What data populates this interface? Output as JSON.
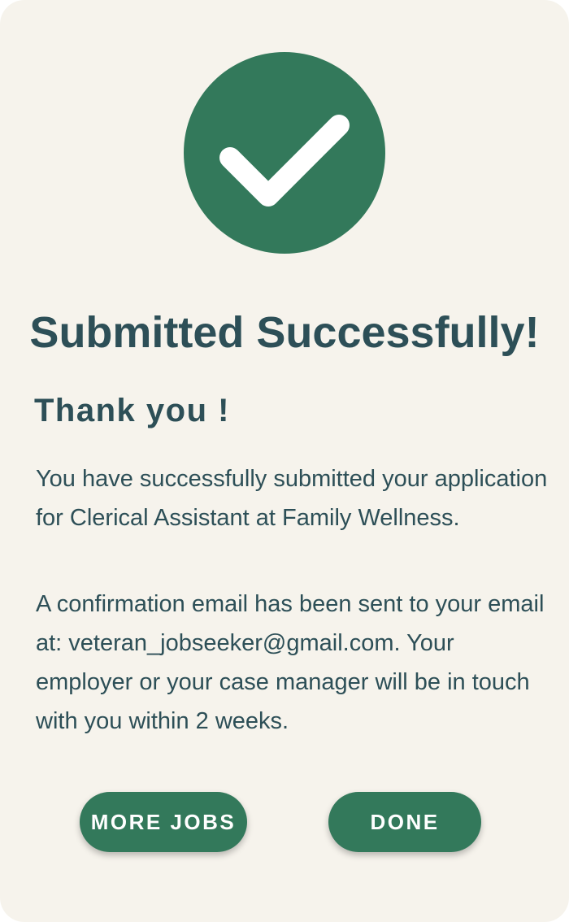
{
  "success": {
    "icon": "checkmark-icon",
    "title": "Submitted Successfully!"
  },
  "message": {
    "heading": "Thank you !",
    "paragraph1": "You have successfully submitted your application for Clerical Assistant at Family Wellness.",
    "paragraph2": "A confirmation email has been sent to your email at: veteran_jobseeker@gmail.com. Your employer or your case manager will be in touch with you within 2 weeks."
  },
  "actions": {
    "more_jobs_label": "MORE JOBS",
    "done_label": "DONE"
  },
  "colors": {
    "accent": "#33795b",
    "text": "#2d4f57",
    "background": "#f6f3ec"
  }
}
